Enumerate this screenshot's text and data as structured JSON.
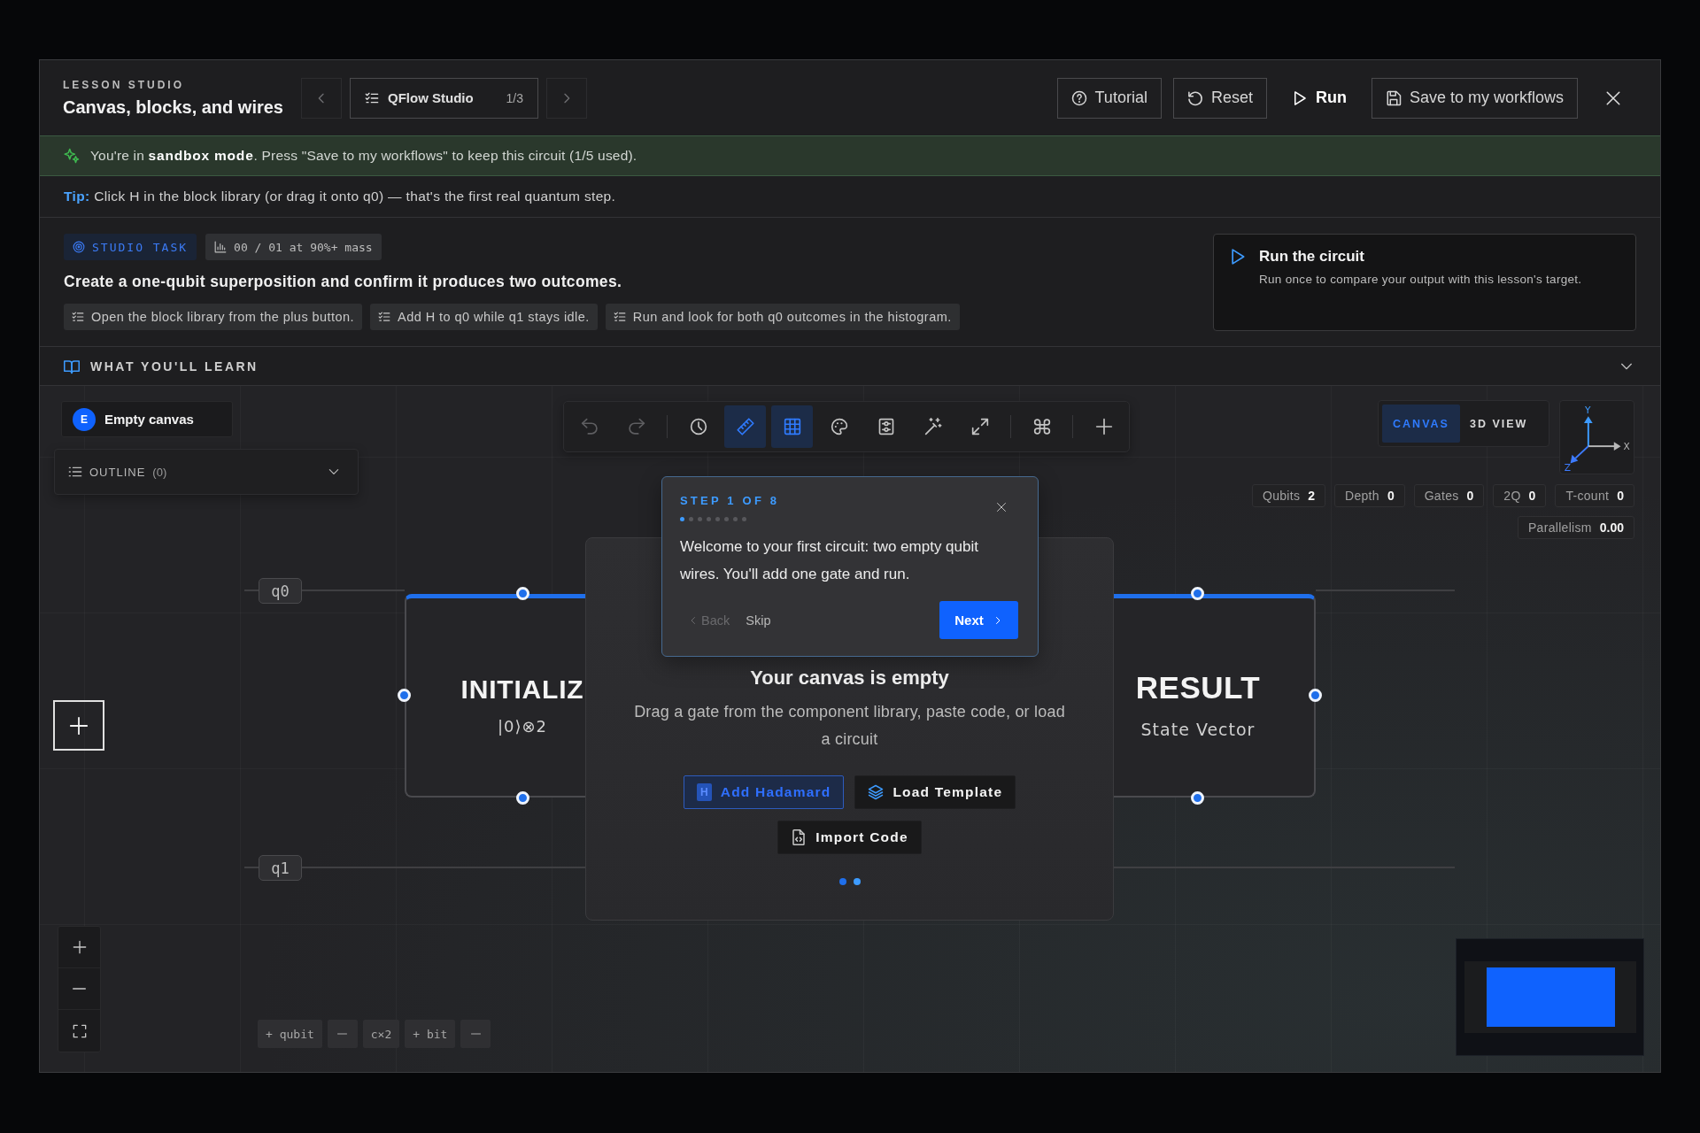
{
  "header": {
    "eyebrow": "LESSON STUDIO",
    "title": "Canvas, blocks, and wires",
    "lesson_switcher": {
      "name": "QFlow Studio",
      "position": "1/3"
    },
    "buttons": [
      {
        "kind": "outline",
        "label": "Tutorial"
      },
      {
        "kind": "outline",
        "label": "Reset"
      },
      {
        "kind": "plain",
        "label": "Run"
      },
      {
        "kind": "outline",
        "label": "Save to my workflows"
      }
    ]
  },
  "sandbox_banner": {
    "text": "You're in **sandbox mode**. Press \"Save to my workflows\" to keep this circuit (1/5 used)."
  },
  "tip": {
    "text": "**Tip:** Click H in the block library (or drag it onto q0) — that's the first real quantum step."
  },
  "task": {
    "badge": "STUDIO TASK",
    "metric": "00 / 01 at 90%+ mass",
    "heading": "Create a one-qubit superposition and confirm it produces two outcomes.",
    "steps": [
      "Open the block library from the plus button.",
      "Add H to q0 while q1 stays idle.",
      "Run and look for both q0 outcomes in the histogram."
    ],
    "goal_card": {
      "title": "Run the circuit",
      "text": "Run once to compare your output with this lesson's target."
    }
  },
  "learn_section": {
    "title": "WHAT YOU'LL LEARN",
    "expanded": false
  },
  "canvas": {
    "file_chip": {
      "avatar": "E",
      "name": "Empty canvas"
    },
    "outline": {
      "label": "OUTLINE",
      "count": "(0)",
      "expanded": false
    },
    "toolbar": {
      "groups": [
        [
          {
            "selected": false,
            "disabled": true
          },
          {
            "selected": false,
            "disabled": true
          }
        ],
        [
          {
            "selected": false,
            "disabled": false
          },
          {
            "selected": true,
            "disabled": false
          },
          {
            "selected": true,
            "disabled": false
          },
          {
            "selected": false,
            "disabled": false
          },
          {
            "selected": false,
            "disabled": false
          },
          {
            "selected": false,
            "disabled": false
          },
          {
            "selected": false,
            "disabled": false
          }
        ],
        [
          {
            "selected": false,
            "disabled": false
          }
        ],
        [
          {
            "selected": false,
            "disabled": false
          }
        ]
      ]
    },
    "view_tabs": [
      {
        "label": "CANVAS",
        "selected": true
      },
      {
        "label": "3D VIEW",
        "selected": false
      }
    ],
    "axis_gizmo": {
      "y": "Y",
      "x": "X",
      "z": "Z"
    },
    "stats": [
      {
        "label": "Qubits",
        "value": "2"
      },
      {
        "label": "Depth",
        "value": "0"
      },
      {
        "label": "Gates",
        "value": "0"
      },
      {
        "label": "2Q",
        "value": "0"
      },
      {
        "label": "T-count",
        "value": "0"
      }
    ],
    "parallelism": {
      "label": "Parallelism",
      "value": "0.00"
    },
    "wires": [
      {
        "label": "q0"
      },
      {
        "label": "q1"
      }
    ],
    "blocks": [
      {
        "kind": "init",
        "title": "INITIALIZ",
        "subtitle": "|0⟩⊗2"
      },
      {
        "kind": "result",
        "title": "RESULT",
        "subtitle": "State Vector"
      }
    ],
    "empty_state": {
      "title": "Your canvas is empty",
      "text": "Drag a gate from the component library, paste code, or load a circuit",
      "actions": [
        {
          "kind": "primary",
          "badge": "H",
          "label": "Add Hadamard"
        },
        {
          "kind": "template",
          "label": "Load Template"
        },
        {
          "kind": "import",
          "label": "Import Code"
        }
      ]
    },
    "tour": {
      "step": "STEP 1 OF 8",
      "progress": [
        {
          "selected": true
        },
        {
          "selected": false
        },
        {
          "selected": false
        },
        {
          "selected": false
        },
        {
          "selected": false
        },
        {
          "selected": false
        },
        {
          "selected": false
        },
        {
          "selected": false
        }
      ],
      "text": "Welcome to your first circuit: two empty qubit wires. You'll add one gate and run.",
      "back": {
        "label": "Back",
        "disabled": true
      },
      "skip": "Skip",
      "next": "Next"
    },
    "wire_controls": [
      {
        "kind": "text",
        "label": "+ qubit"
      },
      {
        "kind": "icon"
      },
      {
        "kind": "text",
        "label": "c×2"
      },
      {
        "kind": "text",
        "label": "+ bit"
      },
      {
        "kind": "icon"
      }
    ]
  }
}
